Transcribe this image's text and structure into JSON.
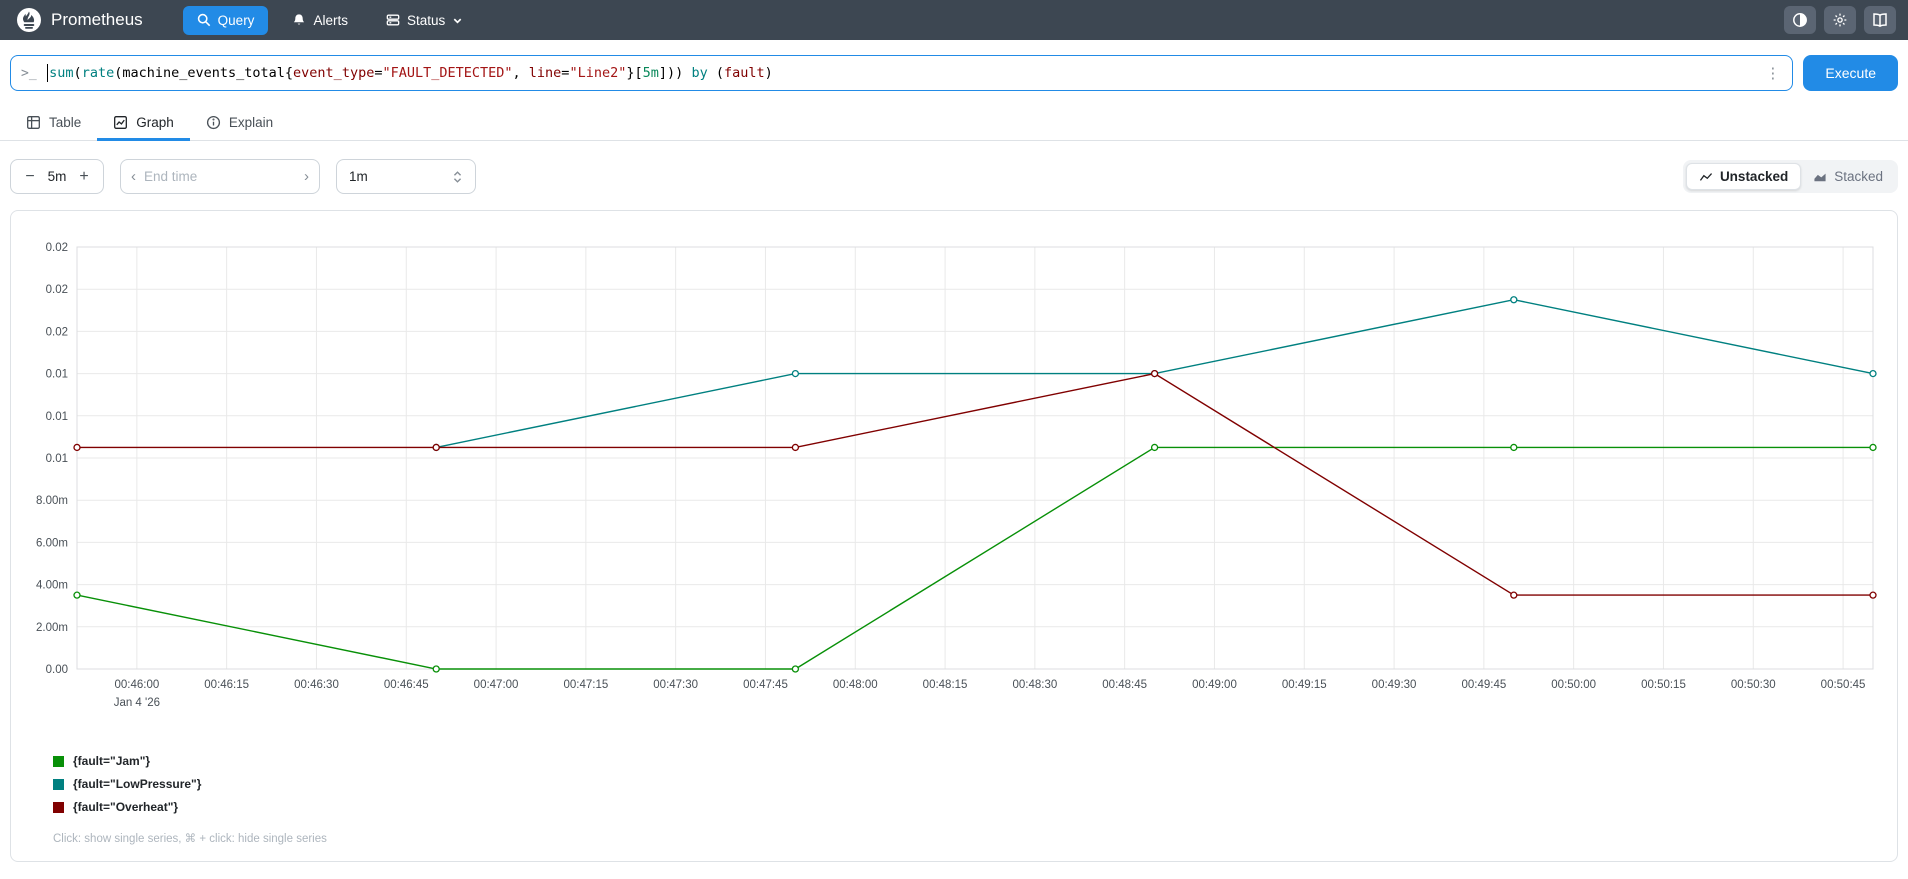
{
  "navbar": {
    "brand": "Prometheus",
    "query_label": "Query",
    "alerts_label": "Alerts",
    "status_label": "Status"
  },
  "query_bar": {
    "prompt": ">_",
    "expression": "sum(rate(machine_events_total{event_type=\"FAULT_DETECTED\", line=\"Line2\"}[5m])) by (fault)",
    "segments": [
      {
        "t": "sum",
        "c": "fn"
      },
      {
        "t": "(",
        "c": "p"
      },
      {
        "t": "rate",
        "c": "fn"
      },
      {
        "t": "(",
        "c": "p"
      },
      {
        "t": "machine_events_total",
        "c": "p"
      },
      {
        "t": "{",
        "c": "p"
      },
      {
        "t": "event_type",
        "c": "lbl"
      },
      {
        "t": "=",
        "c": "p"
      },
      {
        "t": "\"FAULT_DETECTED\"",
        "c": "str"
      },
      {
        "t": ", ",
        "c": "p"
      },
      {
        "t": "line",
        "c": "lbl"
      },
      {
        "t": "=",
        "c": "p"
      },
      {
        "t": "\"Line2\"",
        "c": "str"
      },
      {
        "t": "}",
        "c": "p"
      },
      {
        "t": "[",
        "c": "p"
      },
      {
        "t": "5m",
        "c": "dur"
      },
      {
        "t": "]",
        "c": "p"
      },
      {
        "t": "))",
        "c": "p"
      },
      {
        "t": " ",
        "c": "p"
      },
      {
        "t": "by",
        "c": "kw"
      },
      {
        "t": " (",
        "c": "p"
      },
      {
        "t": "fault",
        "c": "lbl"
      },
      {
        "t": ")",
        "c": "p"
      }
    ],
    "kebab": "⋮",
    "execute_label": "Execute"
  },
  "tabs": {
    "table": "Table",
    "graph": "Graph",
    "explain": "Explain",
    "active": "Graph"
  },
  "controls": {
    "range": {
      "minus": "−",
      "value": "5m",
      "plus": "+"
    },
    "end_time": {
      "prev": "‹",
      "placeholder": "End time",
      "next": "›"
    },
    "resolution": {
      "value": "1m"
    },
    "stack_toggle": {
      "unstacked": "Unstacked",
      "stacked": "Stacked",
      "selected": "Unstacked"
    }
  },
  "graph": {
    "hint": "Click: show single series, ⌘ + click: hide single series"
  },
  "chart_data": {
    "type": "line",
    "title": "",
    "xlabel": "",
    "ylabel": "",
    "grid": true,
    "legend_position": "bottom-left",
    "ylim": [
      0,
      0.02
    ],
    "x_range_seconds": [
      0,
      300
    ],
    "x_sample_labels": [
      "00:45:50",
      "00:46:50",
      "00:47:50",
      "00:48:50",
      "00:49:50",
      "00:50:50"
    ],
    "x_offsets_seconds": [
      0,
      60,
      120,
      180,
      240,
      300
    ],
    "date_sublabel": "Jan 4 '26",
    "x_ticks": [
      {
        "sec": 10,
        "label": "00:46:00",
        "sub": "Jan 4 '26"
      },
      {
        "sec": 25,
        "label": "00:46:15"
      },
      {
        "sec": 40,
        "label": "00:46:30"
      },
      {
        "sec": 55,
        "label": "00:46:45"
      },
      {
        "sec": 70,
        "label": "00:47:00"
      },
      {
        "sec": 85,
        "label": "00:47:15"
      },
      {
        "sec": 100,
        "label": "00:47:30"
      },
      {
        "sec": 115,
        "label": "00:47:45"
      },
      {
        "sec": 130,
        "label": "00:48:00"
      },
      {
        "sec": 145,
        "label": "00:48:15"
      },
      {
        "sec": 160,
        "label": "00:48:30"
      },
      {
        "sec": 175,
        "label": "00:48:45"
      },
      {
        "sec": 190,
        "label": "00:49:00"
      },
      {
        "sec": 205,
        "label": "00:49:15"
      },
      {
        "sec": 220,
        "label": "00:49:30"
      },
      {
        "sec": 235,
        "label": "00:49:45"
      },
      {
        "sec": 250,
        "label": "00:50:00"
      },
      {
        "sec": 265,
        "label": "00:50:15"
      },
      {
        "sec": 280,
        "label": "00:50:30"
      },
      {
        "sec": 295,
        "label": "00:50:45"
      }
    ],
    "y_ticks": [
      {
        "v": 0.02,
        "label": "0.02"
      },
      {
        "v": 0.018,
        "label": "0.02"
      },
      {
        "v": 0.016,
        "label": "0.02"
      },
      {
        "v": 0.014,
        "label": "0.01"
      },
      {
        "v": 0.012,
        "label": "0.01"
      },
      {
        "v": 0.01,
        "label": "0.01"
      },
      {
        "v": 0.008,
        "label": "8.00m"
      },
      {
        "v": 0.006,
        "label": "6.00m"
      },
      {
        "v": 0.004,
        "label": "4.00m"
      },
      {
        "v": 0.002,
        "label": "2.00m"
      },
      {
        "v": 0,
        "label": "0.00"
      }
    ],
    "series": [
      {
        "name": "{fault=\"Jam\"}",
        "color": "#089008",
        "values": [
          0.0035,
          0,
          0,
          0.0105,
          0.0105,
          0.0105
        ]
      },
      {
        "name": "{fault=\"LowPressure\"}",
        "color": "#008080",
        "values": [
          null,
          0.0105,
          0.014,
          0.014,
          0.0175,
          0.014
        ]
      },
      {
        "name": "{fault=\"Overheat\"}",
        "color": "#800000",
        "values": [
          0.0105,
          0.0105,
          0.0105,
          0.014,
          0.0035,
          0.0035
        ]
      }
    ]
  }
}
